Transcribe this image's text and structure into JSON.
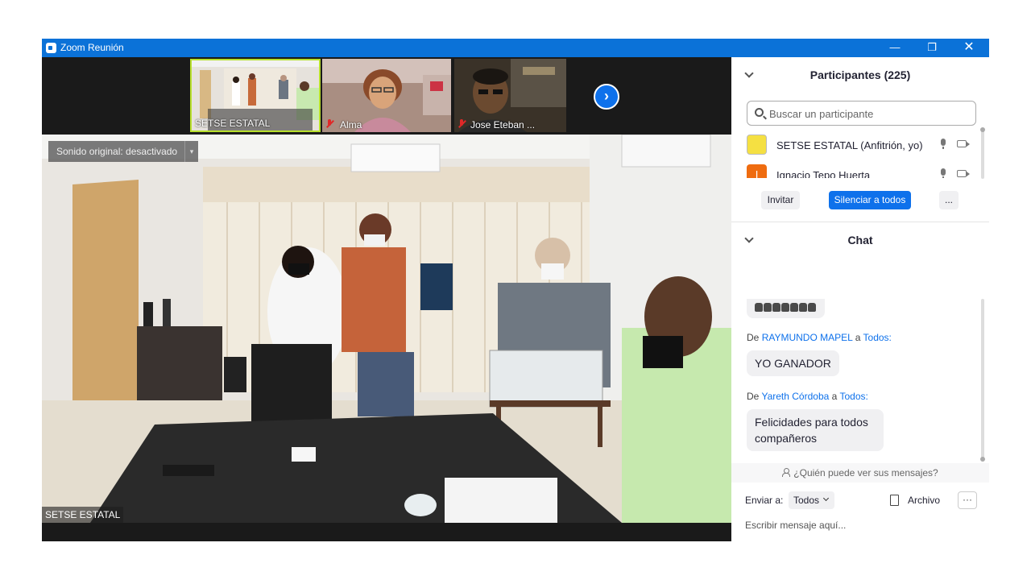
{
  "window": {
    "title": "Zoom Reunión",
    "minimize": "—",
    "maximize": "❐",
    "close": "✕"
  },
  "thumbnails": [
    {
      "label": "SETSE ESTATAL",
      "muted": false
    },
    {
      "label": "Alma",
      "muted": true
    },
    {
      "label": "Jose Eteban ...",
      "muted": true
    }
  ],
  "next_icon": "›",
  "main_video": {
    "sound_option": "Sonido original: desactivado",
    "dropdown_icon": "▾",
    "label": "SETSE ESTATAL"
  },
  "participants": {
    "header": "Participantes (225)",
    "search_placeholder": "Buscar un participante",
    "list": [
      {
        "name": "SETSE ESTATAL (Anfitrión, yo)",
        "avatar_color": "#f5e042",
        "initial": ""
      },
      {
        "name": "Ignacio Tepo Huerta",
        "avatar_color": "#ef6c10",
        "initial": "I"
      }
    ],
    "invite": "Invitar",
    "mute_all": "Silenciar a todos",
    "more": "..."
  },
  "chat": {
    "header": "Chat",
    "messages": [
      {
        "from": "",
        "to": "",
        "text": ""
      },
      {
        "from": "RAYMUNDO MAPEL",
        "to": "Todos:",
        "text": "YO GANADOR"
      },
      {
        "from": "Yareth Córdoba",
        "to": "Todos:",
        "text": "Felicidades para todos compañeros"
      }
    ],
    "from_prefix": "De",
    "to_word": "a",
    "who_can_see": "¿Quién puede ver sus mensajes?",
    "send_to_label": "Enviar a:",
    "send_to_value": "Todos",
    "file_label": "Archivo",
    "more": "···",
    "compose_placeholder": "Escribir mensaje aquí..."
  }
}
